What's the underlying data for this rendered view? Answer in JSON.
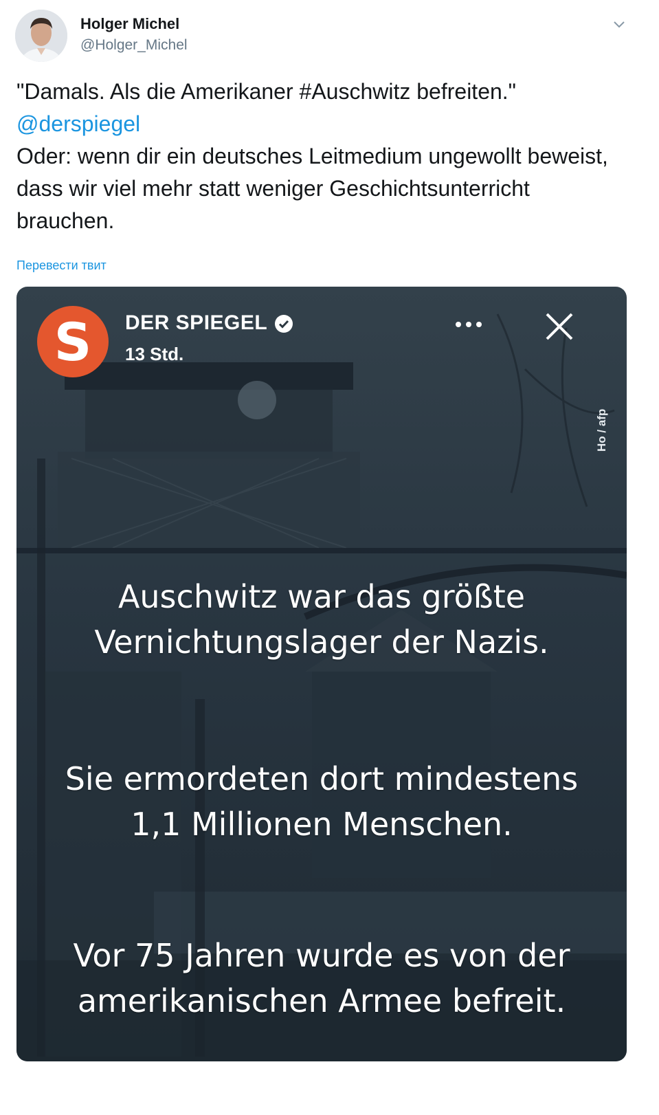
{
  "tweet": {
    "author_name": "Holger Michel",
    "author_handle": "@Holger_Michel",
    "text_line1": "\"Damals. Als die Amerikaner #Auschwitz befreiten.\"",
    "mention": "@derspiegel",
    "text_body": "Oder: wenn dir ein deutsches Leitmedium ungewollt beweist, dass wir viel mehr statt weniger Geschichtsunterricht brauchen.",
    "translate_label": "Перевести твит",
    "link_color": "#1b95e0"
  },
  "media": {
    "logo_letter": "S",
    "logo_color": "#e4572e",
    "source_name": "DER SPIEGEL",
    "timestamp": "13 Std.",
    "photo_credit": "Ho / afp",
    "paragraph1_line1": "Auschwitz war das größte",
    "paragraph1_line2": "Vernichtungslager der Nazis.",
    "paragraph2_line1": "Sie ermordeten dort mindestens",
    "paragraph2_line2": "1,1 Millionen Menschen.",
    "paragraph3_line1": "Vor 75 Jahren wurde es von der",
    "paragraph3_line2": "amerikanischen Armee befreit."
  },
  "icons": {
    "caret": "chevron-down-icon",
    "verified": "verified-badge-icon",
    "more": "more-options-icon",
    "close": "close-icon"
  }
}
